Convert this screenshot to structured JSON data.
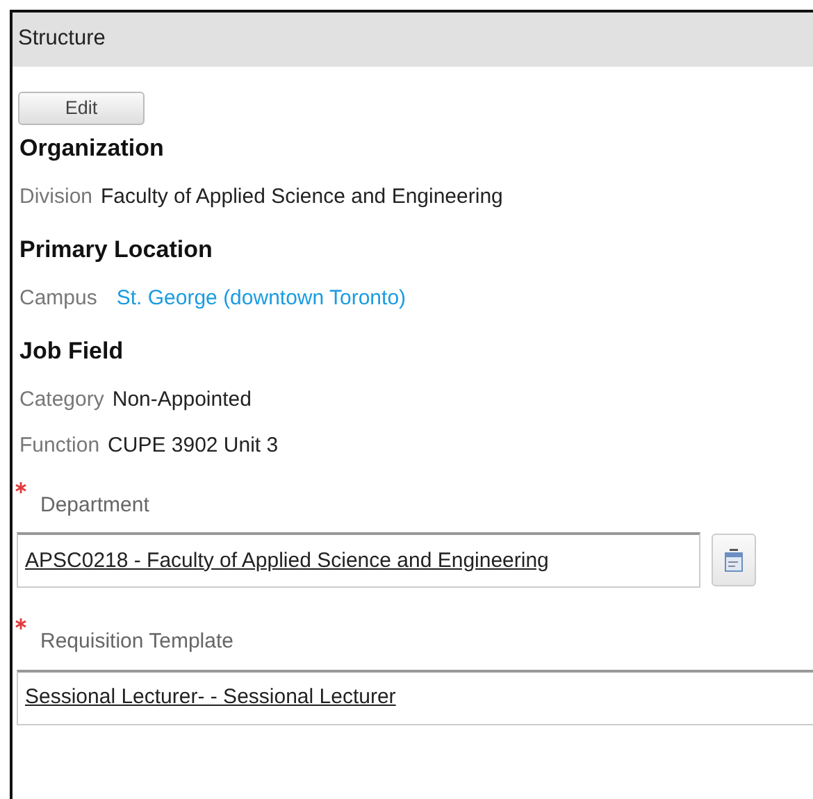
{
  "panel": {
    "title": "Structure"
  },
  "edit_button": "Edit",
  "sections": [
    {
      "heading": "Organization",
      "rows": [
        {
          "label": "Division",
          "value": "Faculty of Applied Science and Engineering",
          "kind": "text"
        }
      ]
    },
    {
      "heading": "Primary Location",
      "rows": [
        {
          "label": "Campus",
          "value": "St. George (downtown Toronto)",
          "kind": "link"
        }
      ]
    },
    {
      "heading": "Job Field",
      "rows": [
        {
          "label": "Category",
          "value": "Non-Appointed",
          "kind": "text"
        },
        {
          "label": "Function",
          "value": "CUPE 3902 Unit 3",
          "kind": "text"
        }
      ]
    }
  ],
  "fields": [
    {
      "label": "Department",
      "required": true,
      "value": "APSC0218 - Faculty of Applied Science and Engineering",
      "picker": true
    },
    {
      "label": "Requisition Template",
      "required": true,
      "value": "Sessional Lecturer- - Sessional Lecturer",
      "picker": false
    }
  ]
}
